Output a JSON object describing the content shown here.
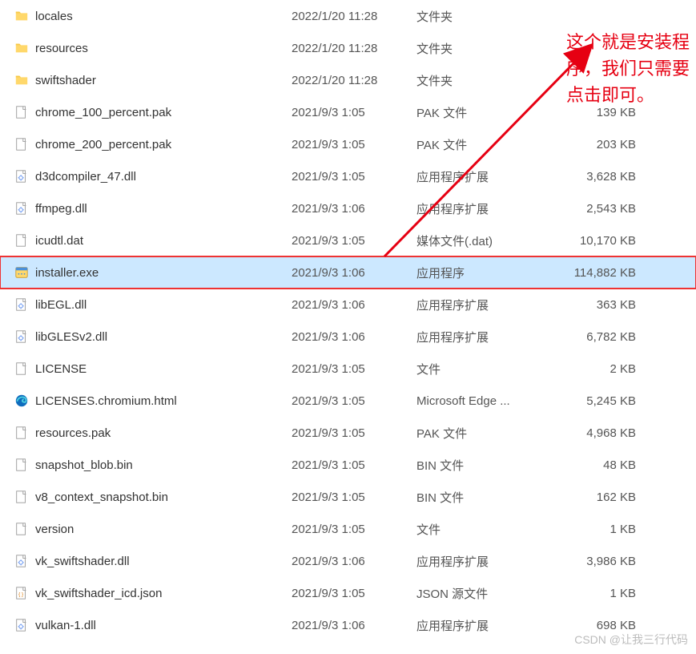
{
  "annotation_text": "这个就是安装程\n序，我们只需要\n点击即可。",
  "watermark": "CSDN @让我三行代码",
  "files": [
    {
      "icon": "folder-icon",
      "name": "locales",
      "date": "2022/1/20 11:28",
      "type": "文件夹",
      "size": ""
    },
    {
      "icon": "folder-icon",
      "name": "resources",
      "date": "2022/1/20 11:28",
      "type": "文件夹",
      "size": ""
    },
    {
      "icon": "folder-icon",
      "name": "swiftshader",
      "date": "2022/1/20 11:28",
      "type": "文件夹",
      "size": ""
    },
    {
      "icon": "file-icon",
      "name": "chrome_100_percent.pak",
      "date": "2021/9/3 1:05",
      "type": "PAK 文件",
      "size": "139 KB"
    },
    {
      "icon": "file-icon",
      "name": "chrome_200_percent.pak",
      "date": "2021/9/3 1:05",
      "type": "PAK 文件",
      "size": "203 KB"
    },
    {
      "icon": "dll-icon",
      "name": "d3dcompiler_47.dll",
      "date": "2021/9/3 1:05",
      "type": "应用程序扩展",
      "size": "3,628 KB"
    },
    {
      "icon": "dll-icon",
      "name": "ffmpeg.dll",
      "date": "2021/9/3 1:06",
      "type": "应用程序扩展",
      "size": "2,543 KB"
    },
    {
      "icon": "file-icon",
      "name": "icudtl.dat",
      "date": "2021/9/3 1:05",
      "type": "媒体文件(.dat)",
      "size": "10,170 KB"
    },
    {
      "icon": "exe-icon",
      "name": "installer.exe",
      "date": "2021/9/3 1:06",
      "type": "应用程序",
      "size": "114,882 KB",
      "selected": true
    },
    {
      "icon": "dll-icon",
      "name": "libEGL.dll",
      "date": "2021/9/3 1:06",
      "type": "应用程序扩展",
      "size": "363 KB"
    },
    {
      "icon": "dll-icon",
      "name": "libGLESv2.dll",
      "date": "2021/9/3 1:06",
      "type": "应用程序扩展",
      "size": "6,782 KB"
    },
    {
      "icon": "file-icon",
      "name": "LICENSE",
      "date": "2021/9/3 1:05",
      "type": "文件",
      "size": "2 KB"
    },
    {
      "icon": "edge-icon",
      "name": "LICENSES.chromium.html",
      "date": "2021/9/3 1:05",
      "type": "Microsoft Edge ...",
      "size": "5,245 KB"
    },
    {
      "icon": "file-icon",
      "name": "resources.pak",
      "date": "2021/9/3 1:05",
      "type": "PAK 文件",
      "size": "4,968 KB"
    },
    {
      "icon": "file-icon",
      "name": "snapshot_blob.bin",
      "date": "2021/9/3 1:05",
      "type": "BIN 文件",
      "size": "48 KB"
    },
    {
      "icon": "file-icon",
      "name": "v8_context_snapshot.bin",
      "date": "2021/9/3 1:05",
      "type": "BIN 文件",
      "size": "162 KB"
    },
    {
      "icon": "file-icon",
      "name": "version",
      "date": "2021/9/3 1:05",
      "type": "文件",
      "size": "1 KB"
    },
    {
      "icon": "dll-icon",
      "name": "vk_swiftshader.dll",
      "date": "2021/9/3 1:06",
      "type": "应用程序扩展",
      "size": "3,986 KB"
    },
    {
      "icon": "json-icon",
      "name": "vk_swiftshader_icd.json",
      "date": "2021/9/3 1:05",
      "type": "JSON 源文件",
      "size": "1 KB"
    },
    {
      "icon": "dll-icon",
      "name": "vulkan-1.dll",
      "date": "2021/9/3 1:06",
      "type": "应用程序扩展",
      "size": "698 KB"
    }
  ]
}
